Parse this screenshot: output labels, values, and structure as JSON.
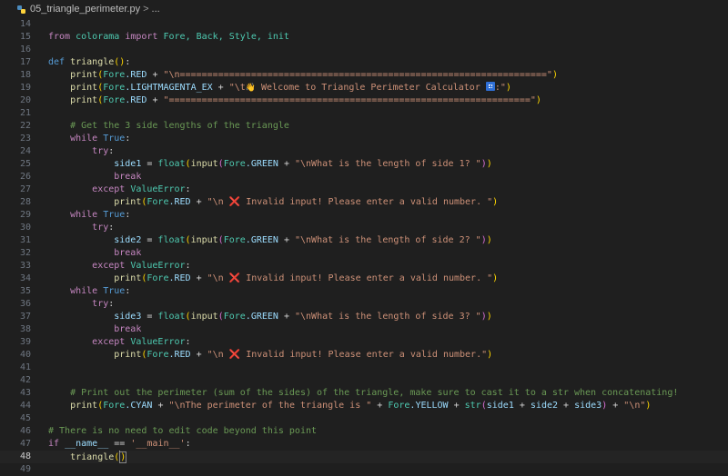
{
  "breadcrumb": {
    "filename": "05_triangle_perimeter.py",
    "separator": ">",
    "more": "..."
  },
  "line_numbers": [
    "14",
    "15",
    "16",
    "17",
    "18",
    "19",
    "20",
    "21",
    "22",
    "23",
    "24",
    "25",
    "26",
    "27",
    "28",
    "29",
    "30",
    "31",
    "32",
    "33",
    "34",
    "35",
    "36",
    "37",
    "38",
    "39",
    "40",
    "41",
    "42",
    "43",
    "44",
    "45",
    "46",
    "47",
    "48",
    "49"
  ],
  "active_line": "48",
  "code": {
    "l15": {
      "from": "from",
      "mod": "colorama",
      "import": "import",
      "names": "Fore, Back, Style, init"
    },
    "l17": {
      "def": "def",
      "name": "triangle",
      "rest": ":"
    },
    "print": "print",
    "fore": "Fore",
    "red": ".RED",
    "plus": " + ",
    "l18_str": "\"\\n===================================================================\"",
    "l19_attr": ".LIGHTMAGENTA_EX",
    "l19_str_a": "\"\\t",
    "l19_wave": "👋",
    "l19_str_b": " Welcome to Triangle Perimeter Calculator ",
    "l19_str_c": ":\"",
    "l20_str": "\"==================================================================\"",
    "l22_comment": "# Get the 3 side lengths of the triangle",
    "while": "while",
    "true": "True",
    "colon": ":",
    "try": "try",
    "float": "float",
    "input": "input",
    "green": ".GREEN",
    "break": "break",
    "except": "except",
    "valueerror": "ValueError",
    "side1": "side1",
    "side2": "side2",
    "side3": "side3",
    "eq": " = ",
    "q1": "\"\\nWhat is the length of side 1? \"",
    "q2": "\"\\nWhat is the length of side 2? \"",
    "q3": "\"\\nWhat is the length of side 3? \"",
    "err_a": "\"\\n ",
    "err_x": "❌",
    "err_b": " Invalid input! Please enter a valid number. \"",
    "err_b_last": " Invalid input! Please enter a valid number.\"",
    "l43_comment": "# Print out the perimeter (sum of the sides) of the triangle, make sure to cast it to a str when concatenating!",
    "cyan": ".CYAN",
    "l44_str": "\"\\nThe perimeter of the triangle is \"",
    "yellow": ".YELLOW",
    "str": "str",
    "l44_sum_op": " + ",
    "l44_nl": "\"\\n\"",
    "l46_comment": "# There is no need to edit code beyond this point",
    "if": "if",
    "dunder_name": "__name__",
    "eqeq": " == ",
    "main_str": "'__main__'",
    "call": "triangle"
  }
}
